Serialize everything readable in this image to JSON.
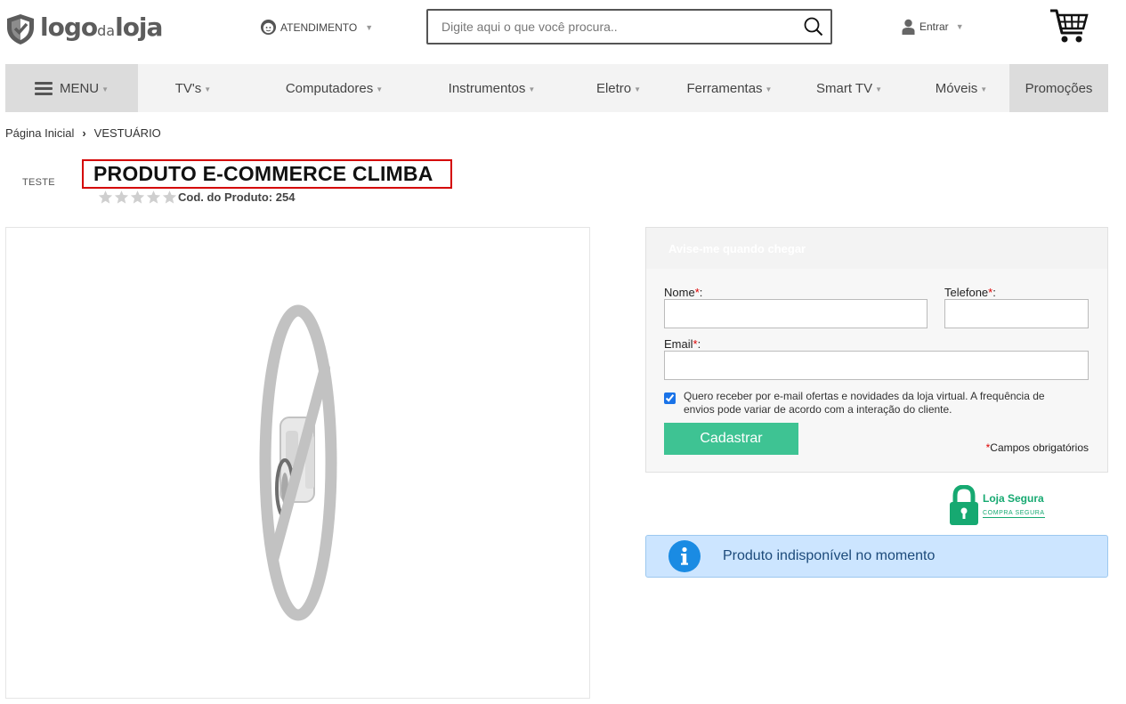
{
  "header": {
    "logo": {
      "main": "logo",
      "middle": "da",
      "end": "loja"
    },
    "atendimento_label": "ATENDIMENTO",
    "search": {
      "placeholder": "Digite aqui o que você procura..",
      "value": ""
    },
    "login_label": "Entrar"
  },
  "nav": {
    "menu_label": "MENU",
    "items": [
      {
        "label": "TV's"
      },
      {
        "label": "Computadores"
      },
      {
        "label": "Instrumentos"
      },
      {
        "label": "Eletro"
      },
      {
        "label": "Ferramentas"
      },
      {
        "label": "Smart TV"
      },
      {
        "label": "Móveis"
      }
    ],
    "promo_label": "Promoções"
  },
  "breadcrumb": {
    "home": "Página Inicial",
    "current": "VESTUÁRIO"
  },
  "product": {
    "brand": "TESTE",
    "title": "PRODUTO E-COMMERCE CLIMBA",
    "rating": 0,
    "rating_max": 5,
    "code_label": "Cod. do Produto: 254"
  },
  "notify": {
    "heading": "Avise-me quando chegar",
    "name_label": "Nome",
    "phone_label": "Telefone",
    "email_label": "Email",
    "required_mark": "*",
    "name_value": "",
    "phone_value": "",
    "email_value": "",
    "optin_text": "Quero receber por e-mail ofertas e novidades da loja virtual. A frequência de envios pode variar de acordo com a interação do cliente.",
    "optin_checked": true,
    "submit_label": "Cadastrar",
    "required_note": "Campos obrigatórios"
  },
  "seal": {
    "title": "Loja Segura",
    "subtitle": "COMPRA SEGURA"
  },
  "alert": {
    "text": "Produto indisponível no momento"
  },
  "colors": {
    "accent_green": "#3ec393",
    "seal_green": "#16a971",
    "alert_bg": "#cce5ff",
    "info_blue": "#1a8be3",
    "title_border": "#d40000"
  },
  "icons": [
    "shield-logo-icon",
    "headset-icon",
    "search-icon",
    "user-icon",
    "cart-icon",
    "hamburger-icon",
    "star-icon",
    "no-image-icon",
    "lock-icon",
    "info-icon"
  ]
}
